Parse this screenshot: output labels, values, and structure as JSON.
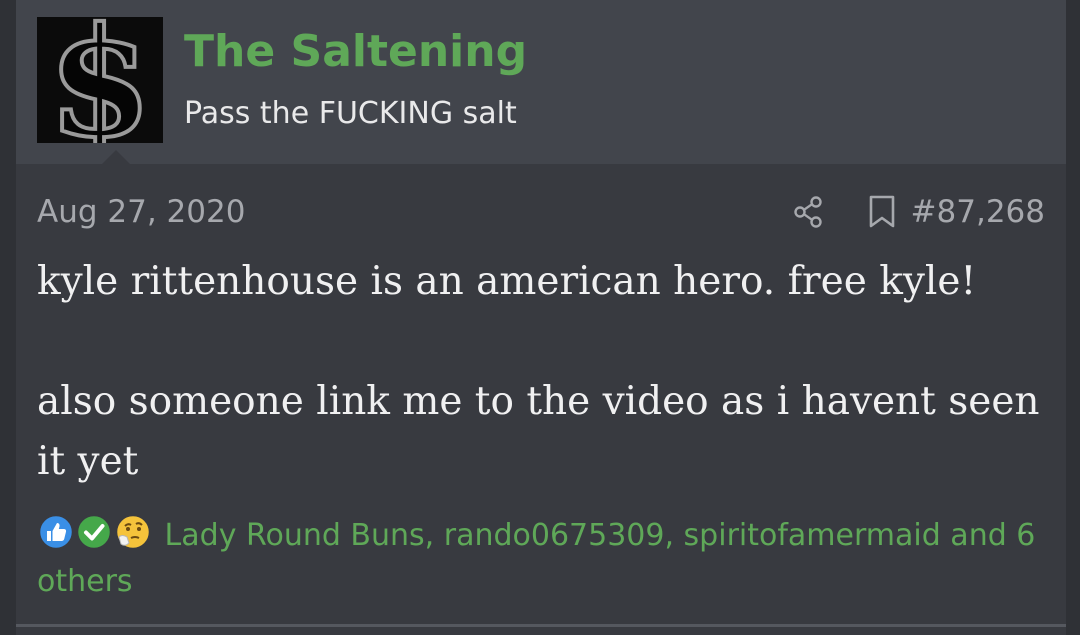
{
  "post": {
    "author": {
      "username": "The Saltening",
      "user_title": "Pass the FUCKING salt",
      "avatar_icon": "dollar-sign-avatar"
    },
    "date": "Aug 27, 2020",
    "post_number": "#87,268",
    "message": {
      "line1": "kyle rittenhouse is an american hero. free kyle!",
      "line2": "also someone link me to the video as i havent seen it yet"
    },
    "reactions": {
      "icons": [
        "like-icon",
        "agree-check-icon",
        "thinking-emoji-icon"
      ],
      "text": "Lady Round Buns, rando0675309, spiritofamermaid and 6 others"
    }
  },
  "colors": {
    "background": "#383a40",
    "header": "#42454c",
    "username": "#5fa858",
    "reaction_link": "#5fa858",
    "muted_text": "#a6a8ad",
    "body_text": "#f0f0f1"
  }
}
